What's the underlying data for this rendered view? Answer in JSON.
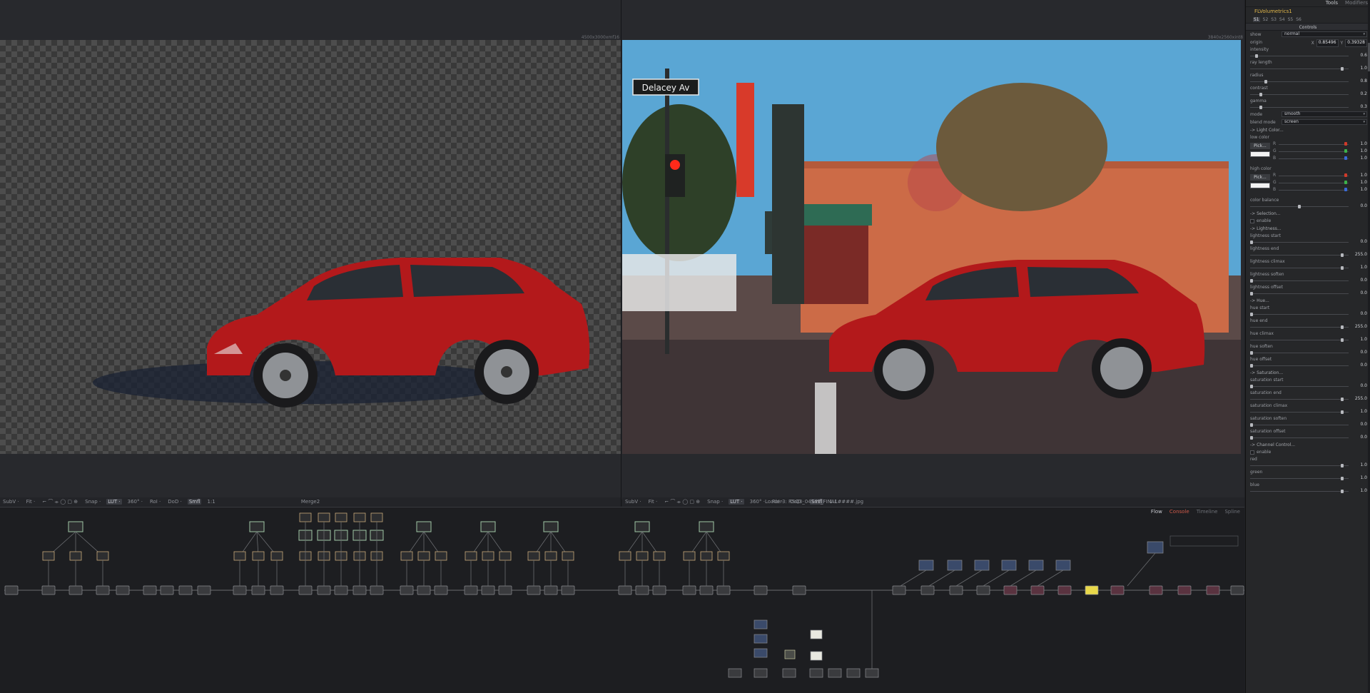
{
  "viewers": {
    "left": {
      "resolution": "4500x3000xmf16",
      "title": "Merge2",
      "toolbar": [
        "SubV ·",
        "Fit ·",
        "Snap ·",
        "LUT ·",
        "360° ·",
        "RoI ·",
        "DoD ·",
        "Smfl",
        "1:1"
      ]
    },
    "right": {
      "resolution": "3840x2560xint8",
      "title": "Loader3: RSQ3_04141_FINAL####.jpg",
      "toolbar": [
        "SubV ·",
        "Fit ·",
        "Snap ·",
        "LUT ·",
        "360° ·",
        "RoI ·",
        "DoD ·",
        "Smfl",
        "1:1"
      ]
    },
    "sign_text": "Delacey Av"
  },
  "flow": {
    "tabs": [
      "Flow",
      "Console",
      "Timeline",
      "Spline"
    ]
  },
  "inspector": {
    "top_tabs": [
      "Tools",
      "Modifiers"
    ],
    "tool_name": "FLVolumetrics1",
    "subtabs": [
      "S1",
      "S2",
      "S3",
      "S4",
      "S5",
      "S6"
    ],
    "controls_header": "Controls",
    "show": {
      "label": "show",
      "value": "normal"
    },
    "origin": {
      "label": "origin",
      "x_label": "X",
      "x": "0.85496",
      "y_label": "Y",
      "y": "0.39328"
    },
    "intensity": {
      "label": "intensity",
      "value": "0.6",
      "fraction": 0.05
    },
    "ray_length": {
      "label": "ray length",
      "value": "1.0",
      "fraction": 0.95
    },
    "radius": {
      "label": "radius",
      "value": "0.8",
      "fraction": 0.15
    },
    "contrast": {
      "label": "contrast",
      "value": "0.2",
      "fraction": 0.1
    },
    "gamma": {
      "label": "gamma",
      "value": "0.3",
      "fraction": 0.1
    },
    "mode": {
      "label": "mode",
      "value": "smooth"
    },
    "blend_mode": {
      "label": "blend mode",
      "value": "screen"
    },
    "light_color_section": "-> Light Color...",
    "low_color": {
      "label": "low color",
      "pick": "Pick...",
      "r": "1.0",
      "g": "1.0",
      "b": "1.0",
      "r_label": "R",
      "g_label": "G",
      "b_label": "B"
    },
    "high_color": {
      "label": "high color",
      "pick": "Pick...",
      "r": "1.0",
      "g": "1.0",
      "b": "1.0",
      "r_label": "R",
      "g_label": "G",
      "b_label": "B"
    },
    "color_balance": {
      "label": "color balance",
      "value": "0.0",
      "fraction": 0.5
    },
    "selection_section": "-> Selection...",
    "enable1": "enable",
    "lightness_section": "-> Lightness...",
    "lightness_start": {
      "label": "lightness start",
      "value": "0.0",
      "fraction": 0.0
    },
    "lightness_end": {
      "label": "lightness end",
      "value": "255.0",
      "fraction": 0.95
    },
    "lightness_climax": {
      "label": "lightness climax",
      "value": "1.0",
      "fraction": 0.95
    },
    "lightness_soften": {
      "label": "lightness soften",
      "value": "0.0",
      "fraction": 0.0
    },
    "lightness_offset": {
      "label": "lightness offset",
      "value": "0.0",
      "fraction": 0.0
    },
    "hue_section": "-> Hue...",
    "hue_start": {
      "label": "hue start",
      "value": "0.0",
      "fraction": 0.0
    },
    "hue_end": {
      "label": "hue end",
      "value": "255.0",
      "fraction": 0.95
    },
    "hue_climax": {
      "label": "hue climax",
      "value": "1.0",
      "fraction": 0.95
    },
    "hue_soften": {
      "label": "hue soften",
      "value": "0.0",
      "fraction": 0.0
    },
    "hue_offset": {
      "label": "hue offset",
      "value": "0.0",
      "fraction": 0.0
    },
    "saturation_section": "-> Saturation...",
    "saturation_start": {
      "label": "saturation start",
      "value": "0.0",
      "fraction": 0.0
    },
    "saturation_end": {
      "label": "saturation end",
      "value": "255.0",
      "fraction": 0.95
    },
    "saturation_climax": {
      "label": "saturation climax",
      "value": "1.0",
      "fraction": 0.95
    },
    "saturation_soften": {
      "label": "saturation soften",
      "value": "0.0",
      "fraction": 0.0
    },
    "saturation_offset": {
      "label": "saturation offset",
      "value": "0.0",
      "fraction": 0.0
    },
    "channel_section": "-> Channel Control...",
    "enable2": "enable",
    "red": {
      "label": "red",
      "value": "1.0",
      "fraction": 0.95
    },
    "green": {
      "label": "green",
      "value": "1.0",
      "fraction": 0.95
    },
    "blue": {
      "label": "blue",
      "value": "1.0",
      "fraction": 0.95
    }
  },
  "colors": {
    "accent": "#e0b64a",
    "car_red": "#b3191b",
    "node_fill": "#3a3b3e"
  }
}
